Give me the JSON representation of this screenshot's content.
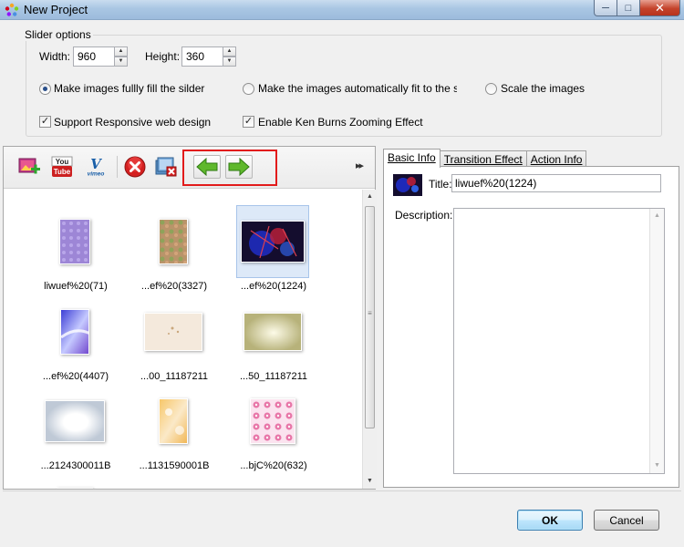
{
  "window": {
    "title": "New Project",
    "min_glyph": "─",
    "max_glyph": "□",
    "close_glyph": "✕"
  },
  "slider_options": {
    "legend": "Slider options",
    "width_label": "Width:",
    "width_value": "960",
    "height_label": "Height:",
    "height_value": "360",
    "spin_up": "▲",
    "spin_down": "▼",
    "radio_fill": "Make images fullly fill the silder",
    "radio_fit": "Make the images automatically fit to the slider",
    "radio_scale": "Scale the images",
    "selected_radio": "fill",
    "check_responsive": "Support Responsive web design",
    "check_kenburns": "Enable Ken Burns Zooming Effect",
    "check_glyph": "✓"
  },
  "toolbar": {
    "icons": [
      "add-image-icon",
      "youtube-icon",
      "vimeo-icon",
      "delete-icon",
      "remove-all-icon",
      "move-left-icon",
      "move-right-icon"
    ],
    "youtube_top": "You",
    "youtube_bottom": "Tube",
    "vimeo_v": "V",
    "vimeo_word": "vimeo",
    "more_glyph": "▸▸",
    "highlight_color": "#e21b1b"
  },
  "scroll": {
    "up": "▲",
    "down": "▼",
    "grip": "≡"
  },
  "thumbnails": [
    {
      "label": "liwuef%20(71)"
    },
    {
      "label": "...ef%20(3327)"
    },
    {
      "label": "...ef%20(1224)"
    },
    {
      "label": "...ef%20(4407)"
    },
    {
      "label": "...00_11187211"
    },
    {
      "label": "...50_11187211"
    },
    {
      "label": "...2124300011B"
    },
    {
      "label": "...1131590001B"
    },
    {
      "label": "...bjC%20(632)"
    }
  ],
  "selected_thumbnail": 2,
  "tabs": [
    {
      "label": "Basic Info"
    },
    {
      "label": "Transition Effect"
    },
    {
      "label": "Action Info"
    }
  ],
  "basic_info": {
    "title_label": "Title:",
    "title_value": "liwuef%20(1224)",
    "description_label": "Description:",
    "description_value": ""
  },
  "buttons": {
    "ok": "OK",
    "cancel": "Cancel"
  }
}
